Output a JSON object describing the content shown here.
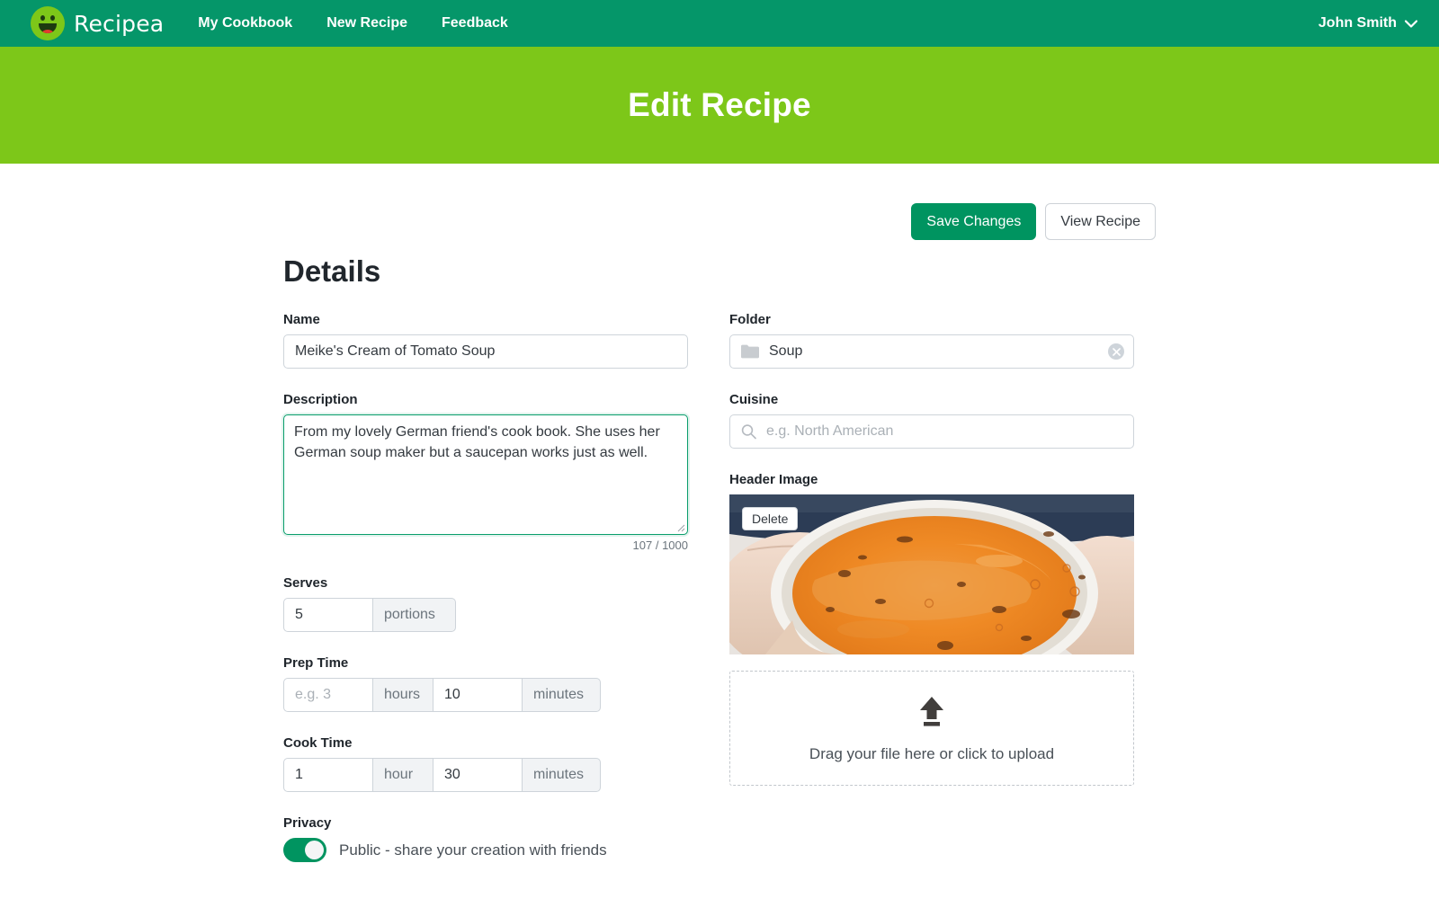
{
  "navbar": {
    "brand": "Recipea",
    "logo_icon": "smiley-logo-icon",
    "links": [
      {
        "label": "My Cookbook"
      },
      {
        "label": "New Recipe"
      },
      {
        "label": "Feedback"
      }
    ],
    "user": "John Smith",
    "user_chevron_icon": "chevron-down-icon",
    "bg_color": "#059669"
  },
  "banner": {
    "title": "Edit Recipe",
    "bg_color": "#7DC719"
  },
  "toolbar": {
    "save_label": "Save Changes",
    "view_label": "View Recipe",
    "primary_color": "#009460"
  },
  "details": {
    "section_title": "Details",
    "name": {
      "label": "Name",
      "value": "Meike's Cream of Tomato Soup"
    },
    "description": {
      "label": "Description",
      "value": "From my lovely German friend's cook book. She uses her German soup maker but a saucepan works just as well.",
      "counter": "107 / 1000",
      "focus_color": "#0a9e6c"
    },
    "serves": {
      "label": "Serves",
      "value": "5",
      "unit": "portions"
    },
    "prep_time": {
      "label": "Prep Time",
      "hours_placeholder": "e.g. 3",
      "hours_value": "",
      "hours_unit": "hours",
      "minutes_value": "10",
      "minutes_unit": "minutes"
    },
    "cook_time": {
      "label": "Cook Time",
      "hours_value": "1",
      "hours_unit": "hour",
      "minutes_value": "30",
      "minutes_unit": "minutes"
    },
    "privacy": {
      "label": "Privacy",
      "toggle_state": "on",
      "toggle_label": "Public - share your creation with friends"
    }
  },
  "sidebar": {
    "folder": {
      "label": "Folder",
      "value": "Soup",
      "icon": "folder-icon",
      "clear_icon": "clear-circle-icon"
    },
    "cuisine": {
      "label": "Cuisine",
      "value": "",
      "placeholder": "e.g. North American",
      "icon": "search-icon"
    },
    "header_image": {
      "label": "Header Image",
      "delete_label": "Delete",
      "alt": "bowl-of-tomato-soup-photo",
      "upload_icon": "upload-arrow-icon",
      "dropzone_text": "Drag your file here or click to upload"
    }
  }
}
